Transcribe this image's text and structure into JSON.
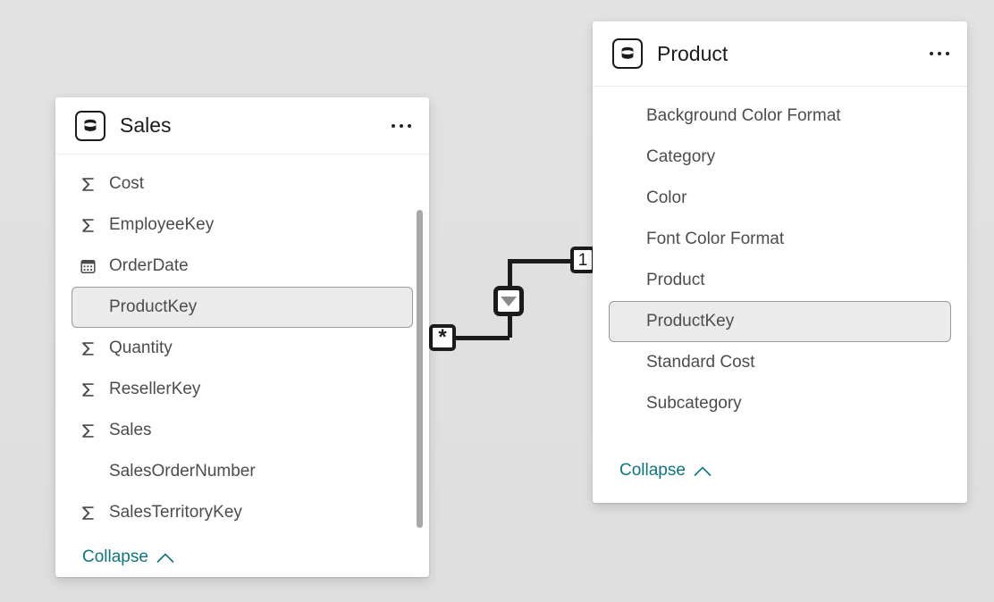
{
  "canvas": {
    "background_color": "#e0e0e0"
  },
  "relationship": {
    "name": "sales-product-relationship",
    "from_table": "Sales",
    "to_table": "Product",
    "from_cardinality": "*",
    "to_cardinality": "1",
    "cross_filter_direction": "single",
    "cross_filter_icon": "arrow-down-icon",
    "line_color": "#1b1b1b"
  },
  "tables": [
    {
      "id": "sales",
      "title": "Sales",
      "icon": "database-icon",
      "menu_icon": "more-options-icon",
      "collapse_label": "Collapse",
      "collapse_icon": "chevron-up-icon",
      "has_scrollbar": true,
      "fields": [
        {
          "label": "Cost",
          "icon": "sigma-icon",
          "selected": false
        },
        {
          "label": "EmployeeKey",
          "icon": "sigma-icon",
          "selected": false
        },
        {
          "label": "OrderDate",
          "icon": "calendar-icon",
          "selected": false
        },
        {
          "label": "ProductKey",
          "icon": "none",
          "selected": true
        },
        {
          "label": "Quantity",
          "icon": "sigma-icon",
          "selected": false
        },
        {
          "label": "ResellerKey",
          "icon": "sigma-icon",
          "selected": false
        },
        {
          "label": "Sales",
          "icon": "sigma-icon",
          "selected": false
        },
        {
          "label": "SalesOrderNumber",
          "icon": "none",
          "selected": false
        },
        {
          "label": "SalesTerritoryKey",
          "icon": "sigma-icon",
          "selected": false
        }
      ]
    },
    {
      "id": "product",
      "title": "Product",
      "icon": "database-icon",
      "menu_icon": "more-options-icon",
      "collapse_label": "Collapse",
      "collapse_icon": "chevron-up-icon",
      "has_scrollbar": false,
      "fields": [
        {
          "label": "Background Color Format",
          "icon": "none",
          "selected": false
        },
        {
          "label": "Category",
          "icon": "none",
          "selected": false
        },
        {
          "label": "Color",
          "icon": "none",
          "selected": false
        },
        {
          "label": "Font Color Format",
          "icon": "none",
          "selected": false
        },
        {
          "label": "Product",
          "icon": "none",
          "selected": false
        },
        {
          "label": "ProductKey",
          "icon": "none",
          "selected": true
        },
        {
          "label": "Standard Cost",
          "icon": "none",
          "selected": false
        },
        {
          "label": "Subcategory",
          "icon": "none",
          "selected": false
        }
      ]
    }
  ],
  "colors": {
    "link": "#12737c",
    "selection_border": "#9b9b9b",
    "selection_fill": "#ebebeb",
    "text": "#4c4c4c",
    "title": "#1b1b1b"
  }
}
